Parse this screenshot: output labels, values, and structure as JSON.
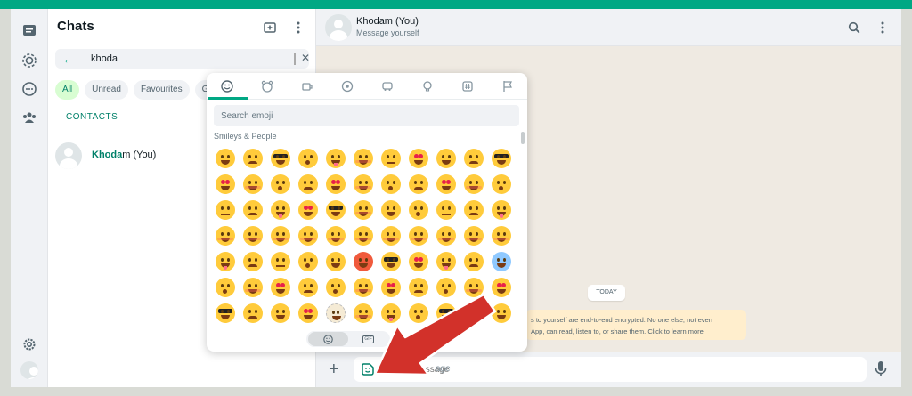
{
  "colors": {
    "accent": "#00a884",
    "accent_dark": "#008069",
    "arrow": "#d2312a",
    "bg": "#efeae2"
  },
  "rail": {
    "icons": [
      "chats-icon",
      "status-icon",
      "channels-icon",
      "communities-icon",
      "settings-icon",
      "profile-avatar"
    ]
  },
  "chatlist": {
    "title": "Chats",
    "search_value": "khoda",
    "filters": [
      "All",
      "Unread",
      "Favourites",
      "Gr"
    ],
    "contacts_label": "CONTACTS",
    "contact": {
      "name_match": "Khoda",
      "name_rest": "m (You)"
    }
  },
  "conversation": {
    "name": "Khodam (You)",
    "subtitle": "Message yourself",
    "date_divider": "TODAY",
    "encryption_notice_line1": "s to yourself are end-to-end encrypted. No one else, not even",
    "encryption_notice_line2": "App, can read, listen to, or share them. Click to learn more",
    "compose_placeholder": "Type a message",
    "compose_visible_text": "age"
  },
  "emoji_picker": {
    "tabs": [
      "smileys-icon",
      "animals-icon",
      "food-icon",
      "activity-icon",
      "travel-icon",
      "objects-icon",
      "symbols-icon",
      "flags-icon"
    ],
    "active_tab": 0,
    "search_placeholder": "Search emoji",
    "category": "Smileys & People",
    "rows": 7,
    "cols": 11,
    "bottom_buttons": [
      "emoji-tab-button",
      "gif-tab-button"
    ],
    "gif_label": "GIF"
  },
  "annotation": {
    "arrow_points_to": "sticker-icon"
  }
}
